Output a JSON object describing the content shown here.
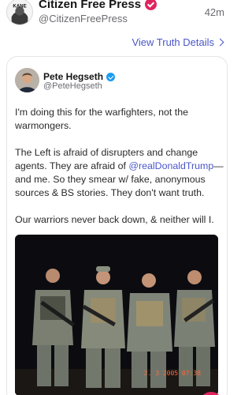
{
  "author": {
    "display_name": "Citizen Free Press",
    "handle": "@CitizenFreePress",
    "time": "42m",
    "avatar_text": "KANE"
  },
  "links": {
    "view_details": "View Truth Details"
  },
  "quoted_post": {
    "display_name": "Pete Hegseth",
    "handle": "@PeteHegseth",
    "paragraphs": {
      "p1": "I'm doing this for the warfighters, not the warmongers.",
      "p2_before": "The Left is afraid of disrupters and change agents. They are afraid of ",
      "p2_mention": "@realDonaldTrump",
      "p2_after": "—and me. So they smear w/ fake, anonymous sources & BS stories. They don't want truth.",
      "p3": "Our warriors never back down, & neither will I."
    },
    "photo_timestamp": "2. 3 2005 07:38"
  },
  "colors": {
    "link": "#4a56c9",
    "verified_red": "#e0245e",
    "verified_blue": "#1d9bf0"
  },
  "icons": {
    "verified_author": "verified-badge-icon",
    "verified_quoted": "verified-badge-icon",
    "details": "chevron-right-icon"
  }
}
